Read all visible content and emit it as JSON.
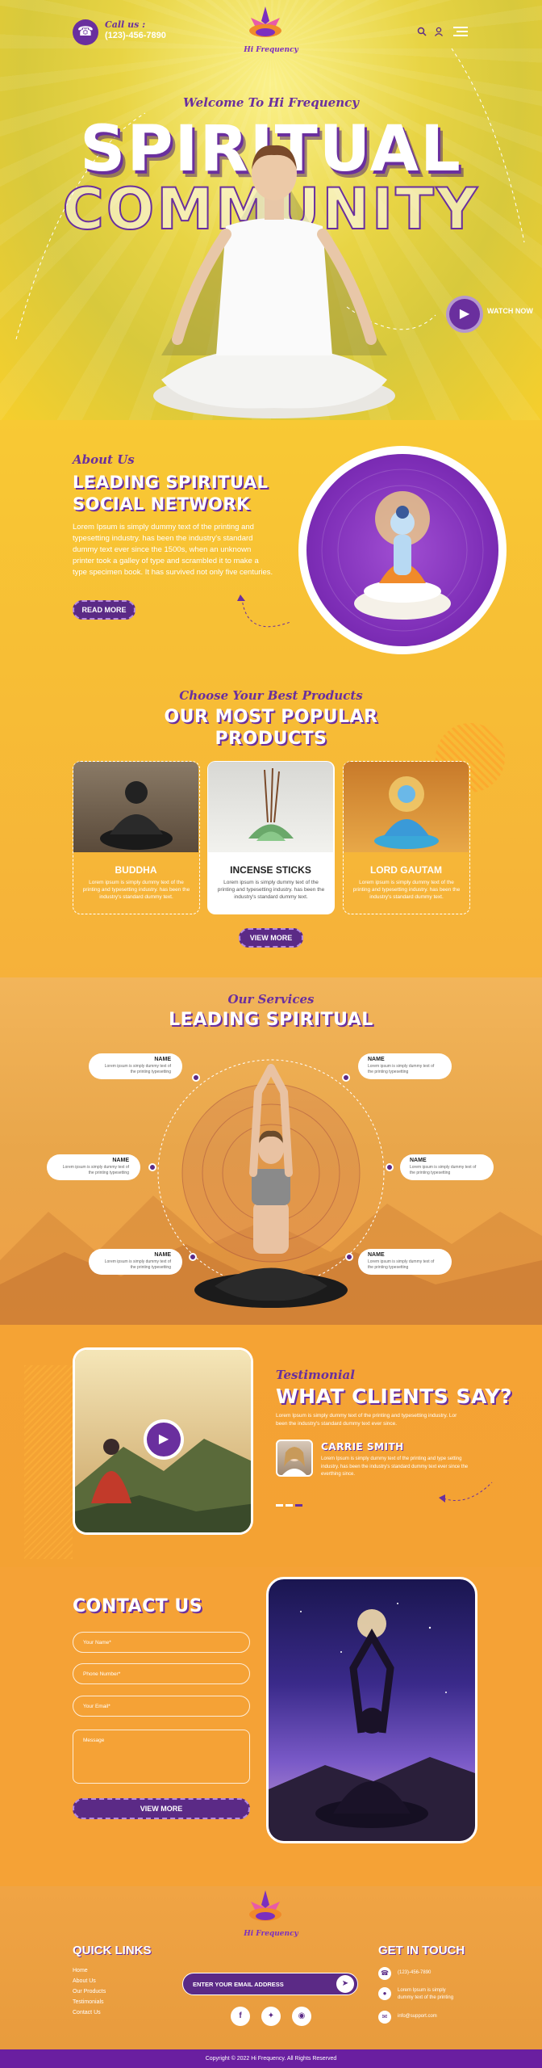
{
  "header": {
    "call_label": "Call us :",
    "phone": "(123)-456-7890",
    "logo_text": "Hi Frequency",
    "search_icon": "search-icon",
    "user_icon": "user-icon",
    "menu_icon": "menu-icon"
  },
  "hero": {
    "welcome": "Welcome To Hi Frequency",
    "title_line1": "SPIRITUAL",
    "title_line2": "COMMUNITY",
    "watch_label": "WATCH NOW"
  },
  "about": {
    "script": "About Us",
    "title_line1": "LEADING SPIRITUAL",
    "title_line2": "SOCIAL NETWORK",
    "body": "Lorem Ipsum is simply dummy text of the printing and typesetting industry. has been the industry's standard dummy text ever since the 1500s, when an unknown printer took a galley of type and scrambled it to make a type specimen book. It has survived not only five centuries.",
    "button": "READ MORE"
  },
  "products": {
    "script": "Choose Your Best Products",
    "title_line1": "OUR MOST POPULAR",
    "title_line2": "PRODUCTS",
    "items": [
      {
        "title": "BUDDHA",
        "text": "Lorem ipsum is simply dummy text of the printing and typesetting industry. has been the industry's standard dummy text."
      },
      {
        "title": "INCENSE STICKS",
        "text": "Lorem ipsum is simply dummy text of the printing and typesetting industry. has been the industry's standard dummy text."
      },
      {
        "title": "LORD GAUTAM",
        "text": "Lorem ipsum is simply dummy text of the printing and typesetting industry. has been the industry's standard dummy text."
      }
    ],
    "button": "VIEW MORE"
  },
  "services": {
    "script": "Our Services",
    "title": "LEADING SPIRITUAL",
    "items": [
      {
        "name": "NAME",
        "desc": "Lorem ipsum is simply dummy text of the printing typesetting"
      },
      {
        "name": "NAME",
        "desc": "Lorem ipsum is simply dummy text of the printing typesetting"
      },
      {
        "name": "NAME",
        "desc": "Lorem ipsum is simply dummy text of the printing typesetting"
      },
      {
        "name": "NAME",
        "desc": "Lorem ipsum is simply dummy text of the printing typesetting"
      },
      {
        "name": "NAME",
        "desc": "Lorem ipsum is simply dummy text of the printing typesetting"
      },
      {
        "name": "NAME",
        "desc": "Lorem ipsum is simply dummy text of the printing typesetting"
      }
    ]
  },
  "testimonial": {
    "script": "Testimonial",
    "title": "WHAT CLIENTS SAY?",
    "intro": "Lorem Ipsum is simply dummy text of the printing and typesetting industry. Lor been the industry's standard dummy text ever since.",
    "name": "CARRIE SMITH",
    "quote": "Lorem Ipsum is simply dummy text of the printing and type setting industry. has been the industry's standard dummy text ever since the everthing since."
  },
  "contact": {
    "title": "CONTACT US",
    "name_placeholder": "Your Name*",
    "phone_placeholder": "Phone Number*",
    "email_placeholder": "Your Email*",
    "message_placeholder": "Message",
    "button": "VIEW MORE"
  },
  "footer": {
    "quick_links_title": "QUICK LINKS",
    "links": [
      "Home",
      "About Us",
      "Our Products",
      "Testimonials",
      "Contact Us"
    ],
    "email_placeholder": "ENTER YOUR EMAIL ADDRESS",
    "logo_text": "Hi Frequency",
    "get_in_touch_title": "GET IN TOUCH",
    "phone": "(123)-456-7890",
    "address": "Lorem Ipsum is simply dummy text of the printing",
    "email": "info@support.com",
    "copyright": "Copyright © 2022 Hi Frequency. All Rights Reserved"
  },
  "colors": {
    "accent_purple": "#6a2f9e",
    "hero_yellow": "#f6cf2c",
    "orange": "#f5a236"
  }
}
